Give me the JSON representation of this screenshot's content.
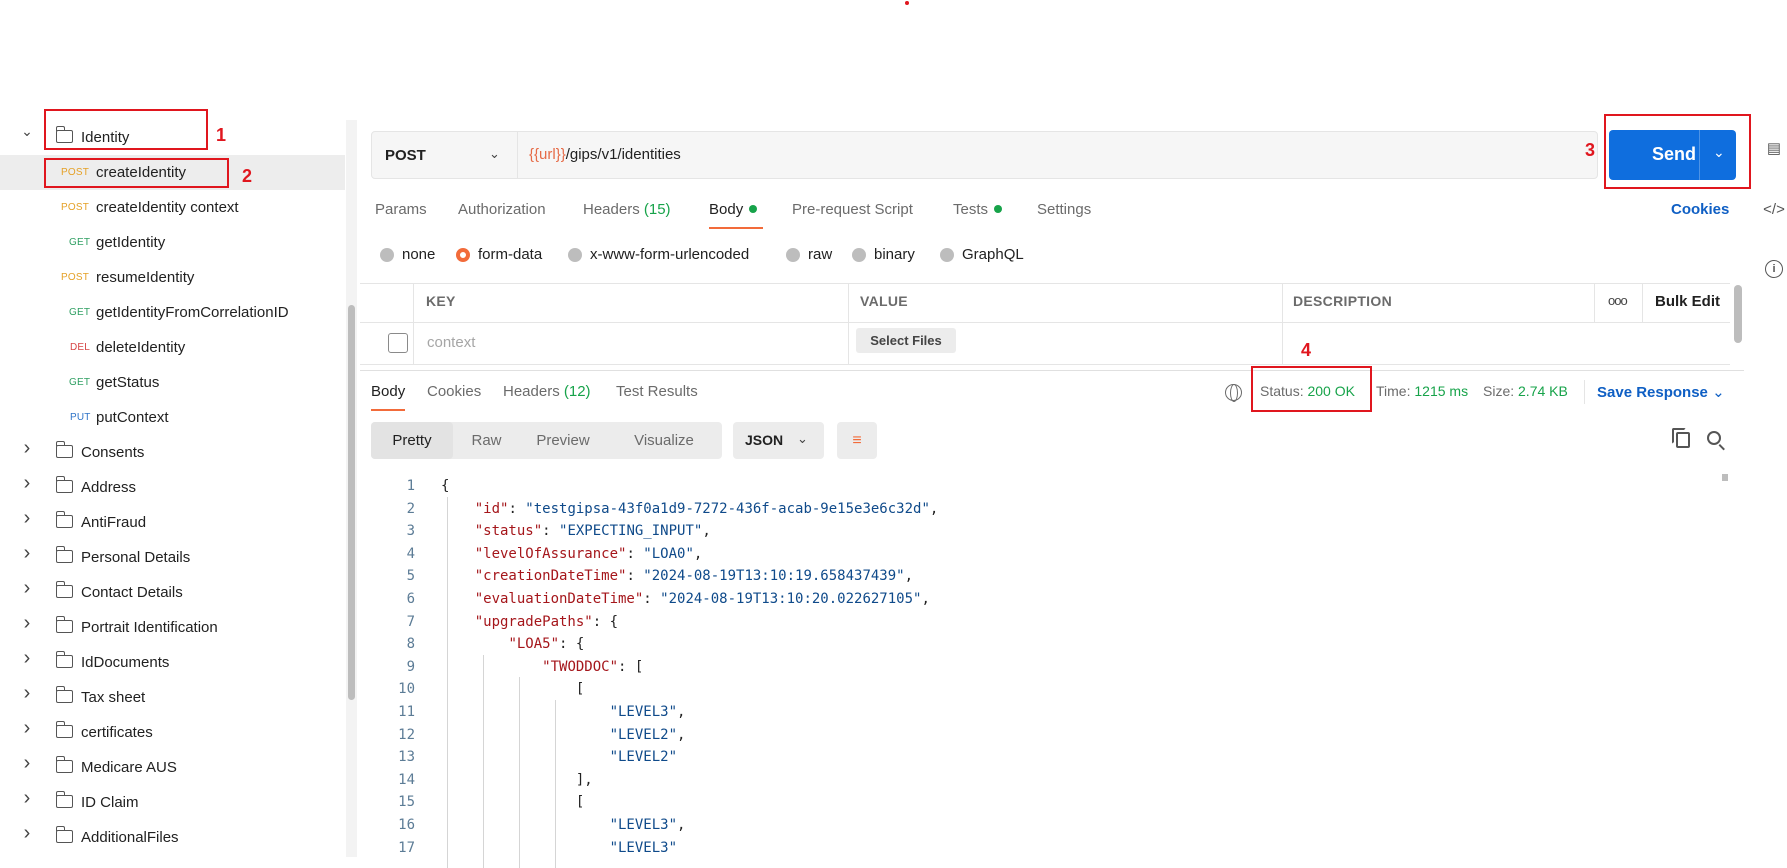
{
  "sidebar": {
    "root_folder": "Identity",
    "requests": [
      {
        "method": "POST",
        "name": "createIdentity",
        "cls": "m-post"
      },
      {
        "method": "POST",
        "name": "createIdentity context",
        "cls": "m-post"
      },
      {
        "method": "GET",
        "name": "getIdentity",
        "cls": "m-get"
      },
      {
        "method": "POST",
        "name": "resumeIdentity",
        "cls": "m-post"
      },
      {
        "method": "GET",
        "name": "getIdentityFromCorrelationID",
        "cls": "m-get"
      },
      {
        "method": "DEL",
        "name": "deleteIdentity",
        "cls": "m-del"
      },
      {
        "method": "GET",
        "name": "getStatus",
        "cls": "m-get"
      },
      {
        "method": "PUT",
        "name": "putContext",
        "cls": "m-put"
      }
    ],
    "folders": [
      "Consents",
      "Address",
      "AntiFraud",
      "Personal Details",
      "Contact Details",
      "Portrait Identification",
      "IdDocuments",
      "Tax sheet",
      "certificates",
      "Medicare AUS",
      "ID Claim",
      "AdditionalFiles"
    ]
  },
  "request": {
    "method": "POST",
    "url_var": "{{url}}",
    "url_path": "/gips/v1/identities",
    "send_label": "Send"
  },
  "request_tabs": {
    "params": "Params",
    "authorization": "Authorization",
    "headers": "Headers",
    "headers_count": "(15)",
    "body": "Body",
    "prerequest": "Pre-request Script",
    "tests": "Tests",
    "settings": "Settings",
    "cookies": "Cookies"
  },
  "body_types": [
    "none",
    "form-data",
    "x-www-form-urlencoded",
    "raw",
    "binary",
    "GraphQL"
  ],
  "table": {
    "key_header": "KEY",
    "value_header": "VALUE",
    "description_header": "DESCRIPTION",
    "more": "ooo",
    "bulk_edit": "Bulk Edit",
    "key_placeholder": "context",
    "select_files": "Select Files"
  },
  "response_tabs": {
    "body": "Body",
    "cookies": "Cookies",
    "headers": "Headers",
    "headers_count": "(12)",
    "test_results": "Test Results"
  },
  "response_meta": {
    "status_label": "Status:",
    "status_value": "200 OK",
    "time_label": "Time:",
    "time_value": "1215 ms",
    "size_label": "Size:",
    "size_value": "2.74 KB",
    "save_response": "Save Response"
  },
  "view": {
    "options": [
      "Pretty",
      "Raw",
      "Preview",
      "Visualize"
    ],
    "format": "JSON"
  },
  "code_lines": [
    [
      [
        "p",
        "{"
      ]
    ],
    [
      [
        "p",
        "    "
      ],
      [
        "k",
        "\"id\""
      ],
      [
        "p",
        ": "
      ],
      [
        "s",
        "\"testgipsa-43f0a1d9-7272-436f-acab-9e15e3e6c32d\""
      ],
      [
        "p",
        ","
      ]
    ],
    [
      [
        "p",
        "    "
      ],
      [
        "k",
        "\"status\""
      ],
      [
        "p",
        ": "
      ],
      [
        "s",
        "\"EXPECTING_INPUT\""
      ],
      [
        "p",
        ","
      ]
    ],
    [
      [
        "p",
        "    "
      ],
      [
        "k",
        "\"levelOfAssurance\""
      ],
      [
        "p",
        ": "
      ],
      [
        "s",
        "\"LOA0\""
      ],
      [
        "p",
        ","
      ]
    ],
    [
      [
        "p",
        "    "
      ],
      [
        "k",
        "\"creationDateTime\""
      ],
      [
        "p",
        ": "
      ],
      [
        "s",
        "\"2024-08-19T13:10:19.658437439\""
      ],
      [
        "p",
        ","
      ]
    ],
    [
      [
        "p",
        "    "
      ],
      [
        "k",
        "\"evaluationDateTime\""
      ],
      [
        "p",
        ": "
      ],
      [
        "s",
        "\"2024-08-19T13:10:20.022627105\""
      ],
      [
        "p",
        ","
      ]
    ],
    [
      [
        "p",
        "    "
      ],
      [
        "k",
        "\"upgradePaths\""
      ],
      [
        "p",
        ": {"
      ]
    ],
    [
      [
        "p",
        "        "
      ],
      [
        "k",
        "\"LOA5\""
      ],
      [
        "p",
        ": {"
      ]
    ],
    [
      [
        "p",
        "            "
      ],
      [
        "k",
        "\"TWODDOC\""
      ],
      [
        "p",
        ": ["
      ]
    ],
    [
      [
        "p",
        "                ["
      ]
    ],
    [
      [
        "p",
        "                    "
      ],
      [
        "s",
        "\"LEVEL3\""
      ],
      [
        "p",
        ","
      ]
    ],
    [
      [
        "p",
        "                    "
      ],
      [
        "s",
        "\"LEVEL2\""
      ],
      [
        "p",
        ","
      ]
    ],
    [
      [
        "p",
        "                    "
      ],
      [
        "s",
        "\"LEVEL2\""
      ]
    ],
    [
      [
        "p",
        "                ],"
      ]
    ],
    [
      [
        "p",
        "                ["
      ]
    ],
    [
      [
        "p",
        "                    "
      ],
      [
        "s",
        "\"LEVEL3\""
      ],
      [
        "p",
        ","
      ]
    ],
    [
      [
        "p",
        "                    "
      ],
      [
        "s",
        "\"LEVEL3\""
      ]
    ]
  ],
  "annotations": [
    "1",
    "2",
    "3",
    "4"
  ]
}
